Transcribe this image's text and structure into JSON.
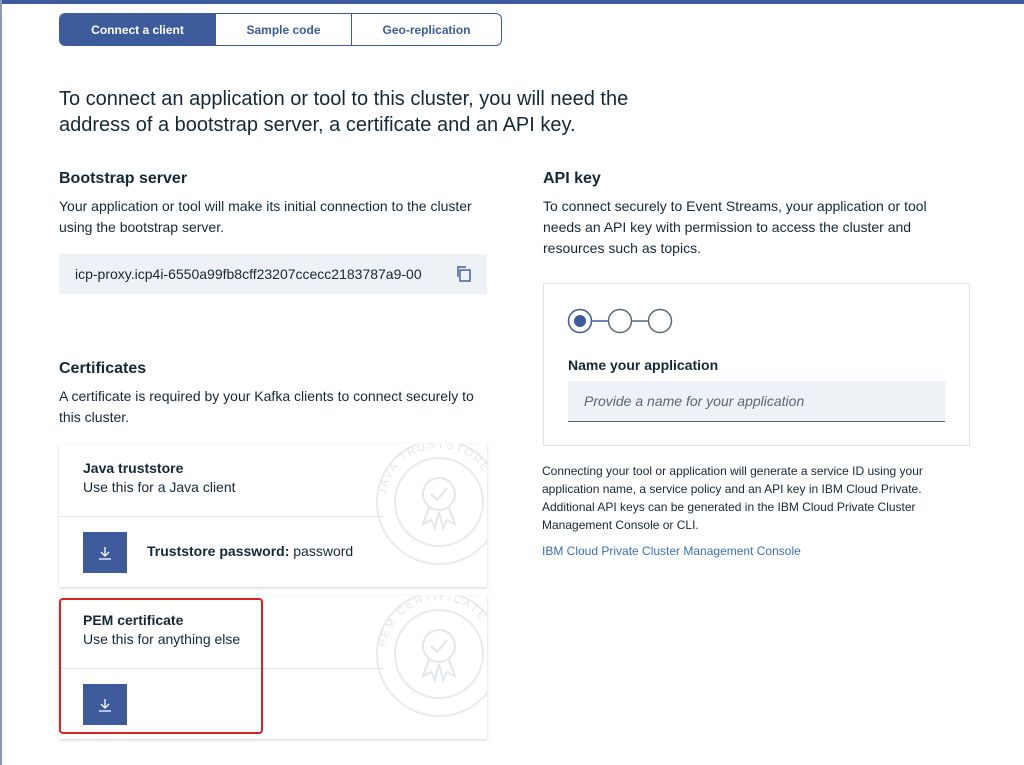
{
  "tabs": [
    {
      "label": "Connect a client",
      "active": true
    },
    {
      "label": "Sample code",
      "active": false
    },
    {
      "label": "Geo-replication",
      "active": false
    }
  ],
  "intro": "To connect an application or tool to this cluster, you will need the address of a bootstrap server, a certificate and an API key.",
  "bootstrap": {
    "heading": "Bootstrap server",
    "description": "Your application or tool will make its initial connection to the cluster using the bootstrap server.",
    "address": "icp-proxy.icp4i-6550a99fb8cff23207ccecc2183787a9-00",
    "copy_icon": "copy-icon"
  },
  "certificates": {
    "heading": "Certificates",
    "description": "A certificate is required by your Kafka clients to connect securely to this cluster.",
    "java": {
      "title": "Java truststore",
      "subtitle": "Use this for a Java client",
      "seal_text": "JAVA TRUSTSTORE",
      "password_label": "Truststore password:",
      "password_value": "password",
      "download_icon": "download-icon"
    },
    "pem": {
      "title": "PEM certificate",
      "subtitle": "Use this for anything else",
      "seal_text": "PEM CERTIFICATE",
      "download_icon": "download-icon"
    }
  },
  "api_key": {
    "heading": "API key",
    "description": "To connect securely to Event Streams, your application or tool needs an API key with permission to access the cluster and resources such as topics.",
    "steps_total": 3,
    "current_step": 1,
    "field_label": "Name your application",
    "field_placeholder": "Provide a name for your application",
    "note": "Connecting your tool or application will generate a service ID using your application name, a service policy and an API key in IBM Cloud Private. Additional API keys can be generated in the IBM Cloud Private Cluster Management Console or CLI.",
    "link_text": "IBM Cloud Private Cluster Management Console"
  },
  "colors": {
    "accent": "#3d5a9b",
    "highlight": "#d9231f",
    "link": "#3d70b2"
  }
}
